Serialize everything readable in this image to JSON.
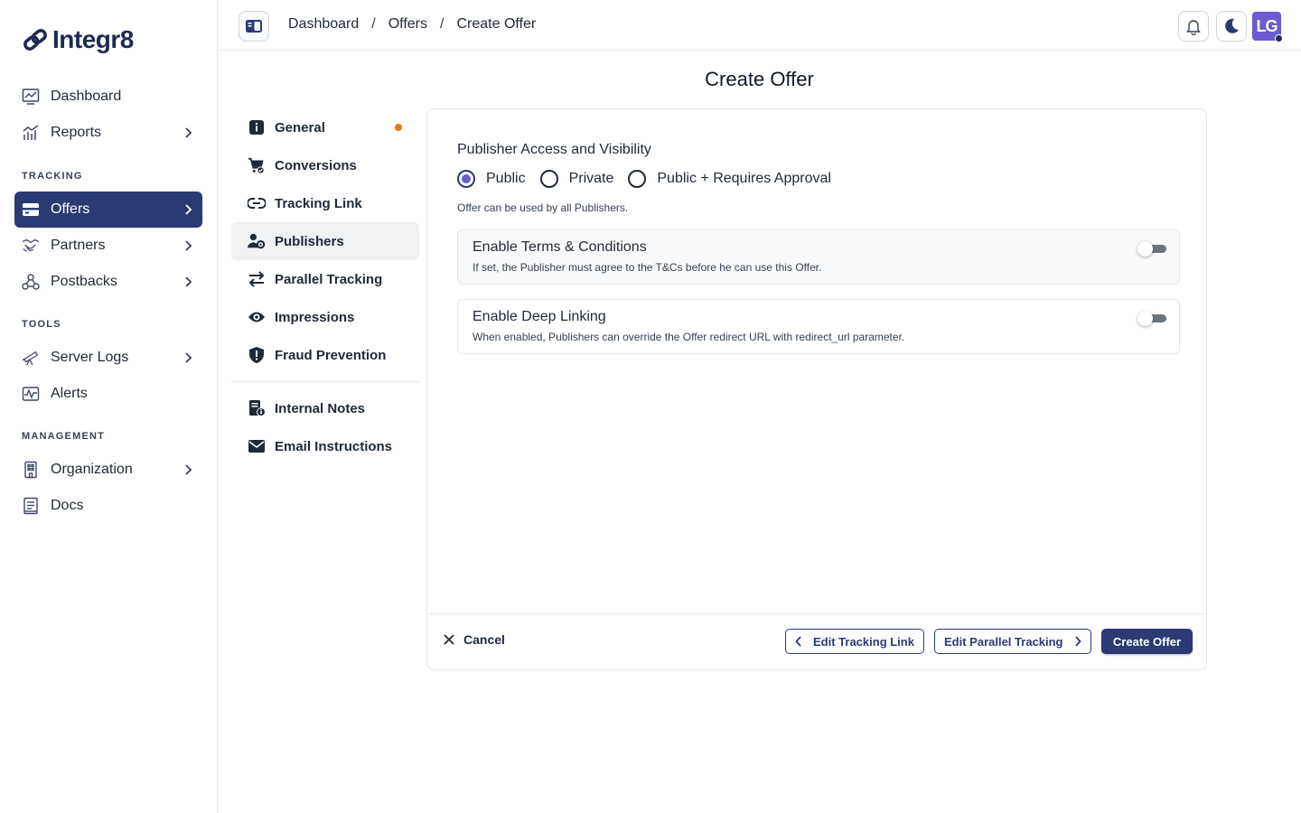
{
  "brand": {
    "name": "Integr8"
  },
  "sidebar": {
    "items_top": [
      {
        "label": "Dashboard",
        "icon": "chart-monitor-icon",
        "chevron": false
      },
      {
        "label": "Reports",
        "icon": "bar-chart-icon",
        "chevron": true
      }
    ],
    "tracking_label": "TRACKING",
    "tracking_items": [
      {
        "label": "Offers",
        "icon": "offers-icon",
        "chevron": true,
        "active": true
      },
      {
        "label": "Partners",
        "icon": "handshake-icon",
        "chevron": true
      },
      {
        "label": "Postbacks",
        "icon": "webhook-icon",
        "chevron": true
      }
    ],
    "tools_label": "TOOLS",
    "tools_items": [
      {
        "label": "Server Logs",
        "icon": "telescope-icon",
        "chevron": true
      },
      {
        "label": "Alerts",
        "icon": "pulse-icon",
        "chevron": false
      }
    ],
    "management_label": "MANAGEMENT",
    "management_items": [
      {
        "label": "Organization",
        "icon": "building-icon",
        "chevron": true
      },
      {
        "label": "Docs",
        "icon": "document-icon",
        "chevron": false
      }
    ]
  },
  "header": {
    "breadcrumb": [
      "Dashboard",
      "Offers",
      "Create Offer"
    ],
    "avatar_initials": "LG"
  },
  "page": {
    "title": "Create Offer"
  },
  "subnav": {
    "items": [
      {
        "label": "General",
        "icon": "info-icon",
        "dot": true
      },
      {
        "label": "Conversions",
        "icon": "cart-check-icon"
      },
      {
        "label": "Tracking Link",
        "icon": "link-icon"
      },
      {
        "label": "Publishers",
        "icon": "users-gear-icon",
        "active": true
      },
      {
        "label": "Parallel Tracking",
        "icon": "arrows-swap-icon"
      },
      {
        "label": "Impressions",
        "icon": "eye-icon"
      },
      {
        "label": "Fraud Prevention",
        "icon": "shield-icon"
      }
    ],
    "extra_items": [
      {
        "label": "Internal Notes",
        "icon": "notes-icon"
      },
      {
        "label": "Email Instructions",
        "icon": "envelope-icon"
      }
    ]
  },
  "publishers": {
    "section_title": "Publisher Access and Visibility",
    "visibility_options": [
      "Public",
      "Private",
      "Public + Requires Approval"
    ],
    "selected": "Public",
    "helper_text": "Offer can be used by all Publishers.",
    "terms": {
      "title": "Enable Terms & Conditions",
      "description": "If set, the Publisher must agree to the T&Cs before he can use this Offer.",
      "enabled": false
    },
    "deep_linking": {
      "title": "Enable Deep Linking",
      "description": "When enabled, Publishers can override the Offer redirect URL with redirect_url parameter.",
      "enabled": false
    }
  },
  "footer": {
    "cancel_label": "Cancel",
    "prev_label": "Edit Tracking Link",
    "next_label": "Edit Parallel Tracking",
    "submit_label": "Create Offer"
  },
  "colors": {
    "brand_navy": "#2c3a74",
    "accent_purple": "#6d5bd0",
    "dot_orange": "#e07b1a"
  }
}
